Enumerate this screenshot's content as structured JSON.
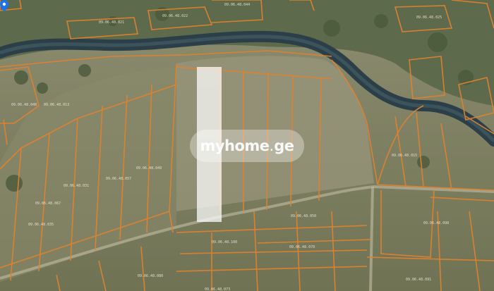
{
  "watermark": {
    "brand": "myhome",
    "dot": ".",
    "suffix": "ge"
  },
  "parcel_labels": [
    "09.06.48.022",
    "09.06.48.044",
    "09.06.48.021",
    "09.06.48.025",
    "09.06.48.013",
    "09.06.48.048",
    "09.06.48.031",
    "09.06.48.057",
    "09.06.48.049",
    "09.06.48.015",
    "09.06.48.067",
    "09.06.48.035",
    "09.06.48.098",
    "09.06.48.050",
    "09.06.48.100",
    "09.06.48.070",
    "09.06.48.073",
    "09.06.48.080",
    "09.06.48.091"
  ],
  "colors": {
    "parcel_boundary": "#e0822f",
    "river": "#2b3f48",
    "highlight": "#ffffff",
    "pin": "#1a73e8"
  },
  "icons": {
    "location": "map-pin-icon"
  }
}
